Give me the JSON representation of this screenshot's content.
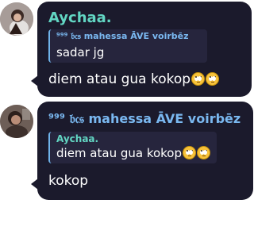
{
  "messages": [
    {
      "sender": "Aychaa.",
      "sender_color": "#62d6c3",
      "reply_to": {
        "name": "⁹⁹⁹ 𝔟𝔠𝔰 mahessa ĀVE voirbēz",
        "name_color": "#7ab8f0",
        "text": "sadar jg"
      },
      "text": "diem atau gua kokop",
      "emojis": [
        "rolling-eyes-emoji",
        "rolling-eyes-emoji"
      ]
    },
    {
      "sender": "⁹⁹⁹ 𝔟𝔠𝔰 mahessa ĀVE voirbēz",
      "sender_color": "#7ab8f0",
      "reply_to": {
        "name": "Aychaa.",
        "name_color": "#62d6c3",
        "text": "diem atau gua kokop",
        "emojis": [
          "rolling-eyes-emoji",
          "rolling-eyes-emoji"
        ]
      },
      "text": "kokop"
    }
  ]
}
